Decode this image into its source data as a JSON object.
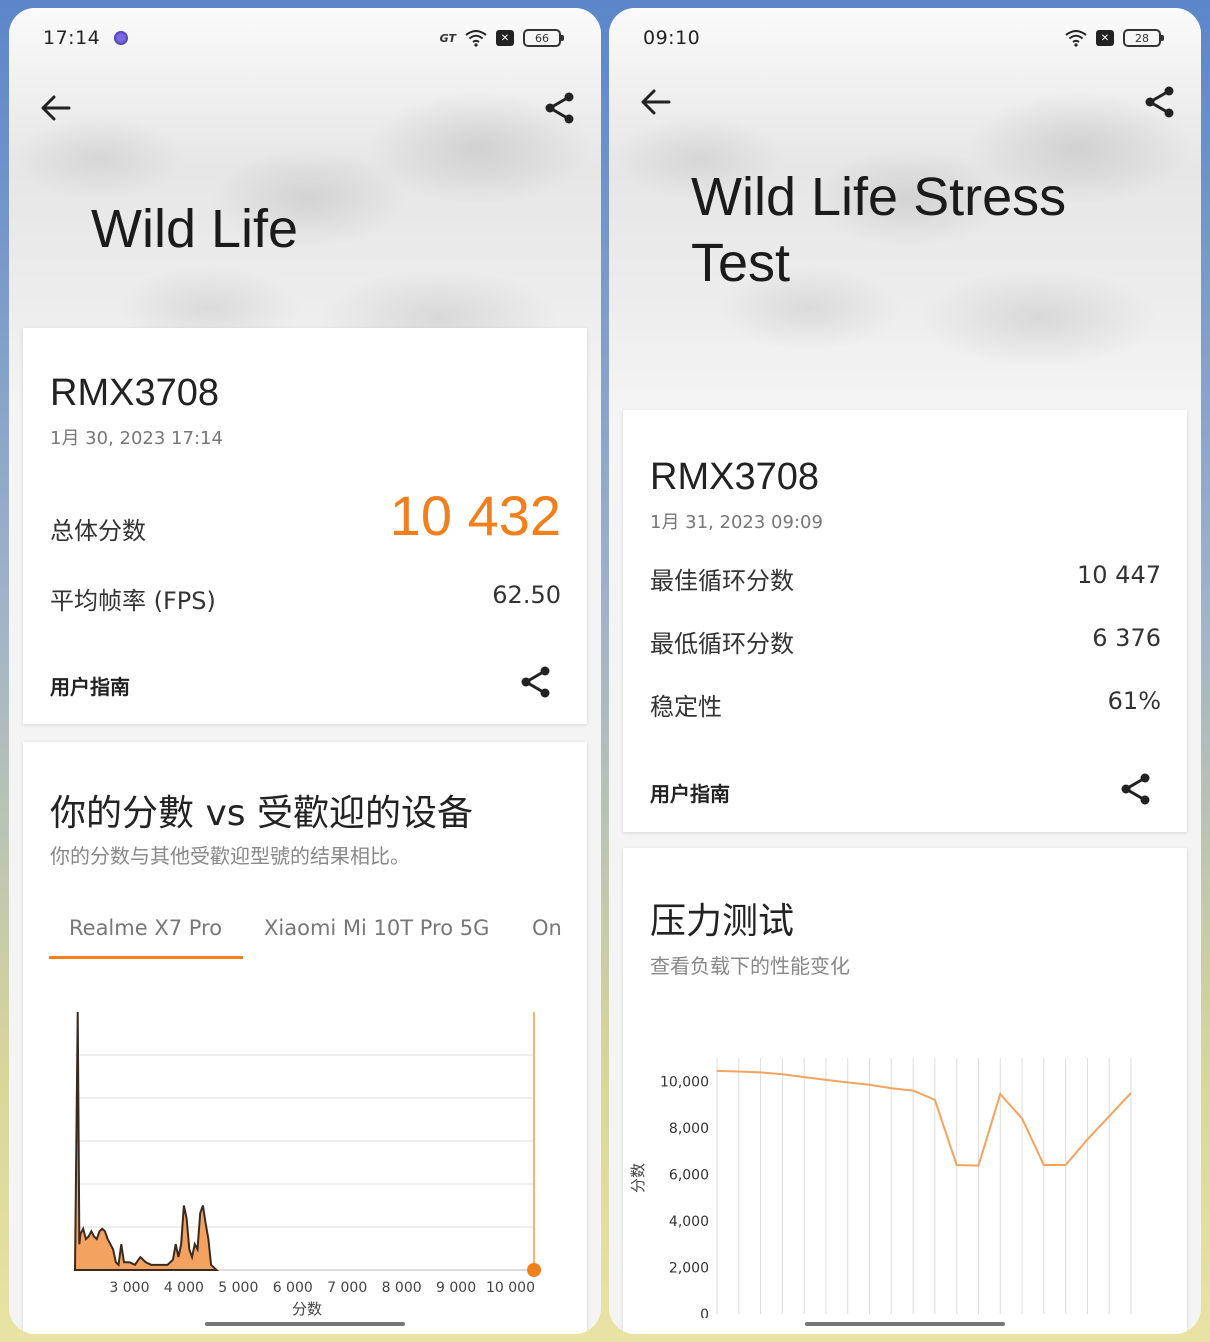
{
  "left": {
    "status": {
      "time": "17:14",
      "battery": "66",
      "gt_label": "GT"
    },
    "title": "Wild Life",
    "device": {
      "name": "RMX3708",
      "date": "1月 30, 2023 17:14"
    },
    "overall_label": "总体分数",
    "overall_score": "10 432",
    "fps_label": "平均帧率 (FPS)",
    "fps_value": "62.50",
    "guide_label": "用户指南",
    "compare_title": "你的分數 vs 受歡迎的设备",
    "compare_subtitle": "你的分数与其他受歡迎型號的结果相比。",
    "tabs": [
      "Realme X7 Pro",
      "Xiaomi Mi 10T Pro 5G",
      "On"
    ],
    "accent_color": "#f07f1c"
  },
  "right": {
    "status": {
      "time": "09:10",
      "battery": "28"
    },
    "title_line1": "Wild Life Stress",
    "title_line2": "Test",
    "device": {
      "name": "RMX3708",
      "date": "1月 31, 2023 09:09"
    },
    "rows": [
      {
        "label": "最佳循环分数",
        "value": "10 447"
      },
      {
        "label": "最低循环分数",
        "value": "6 376"
      },
      {
        "label": "稳定性",
        "value": "61%"
      }
    ],
    "guide_label": "用户指南",
    "stress_title": "压力测试",
    "stress_subtitle": "查看负载下的性能变化"
  },
  "chart_data": [
    {
      "type": "area",
      "title": "",
      "xlabel": "分数",
      "ylabel": "",
      "x_ticks": [
        "3 000",
        "4 000",
        "5 000",
        "6 000",
        "7 000",
        "8 000",
        "9 000",
        "10 000"
      ],
      "xlim": [
        2000,
        10450
      ],
      "series": [
        {
          "x": [
            2000,
            2050,
            2080,
            2100,
            2150,
            2200,
            2250,
            2300,
            2350,
            2400,
            2450,
            2500,
            2550,
            2600,
            2650,
            2700,
            2750,
            2800,
            2850,
            2900,
            3000,
            3100,
            3200,
            3300,
            3400,
            3500,
            3600,
            3700,
            3800,
            3850,
            3900,
            3950,
            4000,
            4050,
            4100,
            4150,
            4200,
            4250,
            4300,
            4350,
            4400,
            4450,
            4500,
            4550,
            4600
          ],
          "values": [
            0,
            100,
            10,
            14,
            16,
            12,
            13,
            15,
            13,
            12,
            15,
            16,
            15,
            12,
            10,
            8,
            3,
            2,
            10,
            3,
            3,
            2,
            5,
            3,
            2,
            2,
            2,
            2,
            4,
            10,
            5,
            10,
            25,
            20,
            8,
            5,
            10,
            8,
            22,
            25,
            18,
            12,
            2,
            1,
            0
          ]
        }
      ],
      "marker": {
        "x": 10432,
        "label": "10 432"
      }
    },
    {
      "type": "line",
      "title": "",
      "xlabel": "",
      "ylabel": "分数",
      "y_ticks": [
        "10,000",
        "8,000",
        "6,000",
        "4,000",
        "2,000",
        "0"
      ],
      "ylim": [
        0,
        11000
      ],
      "x": [
        1,
        2,
        3,
        4,
        5,
        6,
        7,
        8,
        9,
        10,
        11,
        12,
        13,
        14,
        15,
        16,
        17,
        18,
        19,
        20
      ],
      "series": [
        {
          "values": [
            10447,
            10420,
            10380,
            10300,
            10180,
            10060,
            9950,
            9850,
            9700,
            9600,
            9200,
            6400,
            6376,
            9450,
            8400,
            6400,
            6400,
            7500,
            8500,
            9500
          ]
        }
      ]
    }
  ]
}
